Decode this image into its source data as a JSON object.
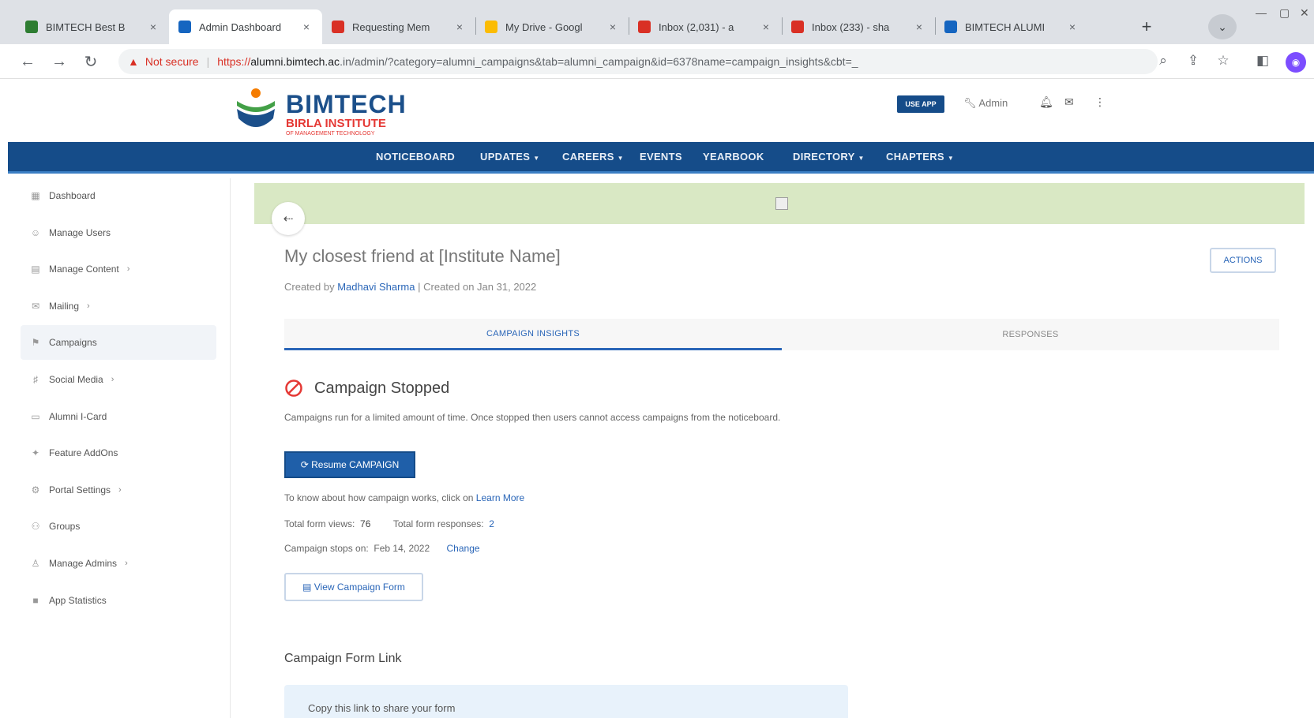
{
  "browser": {
    "tabs": [
      {
        "title": "BIMTECH Best B",
        "favicon_color": "#2e7d32"
      },
      {
        "title": "Admin Dashboard",
        "favicon_color": "#1565c0"
      },
      {
        "title": "Requesting Mem",
        "favicon_color": "#d93025"
      },
      {
        "title": "My Drive - Googl",
        "favicon_color": "#fbbc04"
      },
      {
        "title": "Inbox (2,031) - a",
        "favicon_color": "#d93025"
      },
      {
        "title": "Inbox (233) - sha",
        "favicon_color": "#d93025"
      },
      {
        "title": "BIMTECH ALUMI",
        "favicon_color": "#1565c0"
      }
    ],
    "active_tab": 1,
    "tab_close": "×",
    "new_tab": "+",
    "tab_search": "⌄",
    "address": {
      "warning_label": "Not secure",
      "scheme": "https://",
      "host": "alumni.bimtech.ac",
      "path": ".in/admin/?category=alumni_campaigns&tab=alumni_campaign&id=6378name=campaign_insights&cbt=_"
    }
  },
  "site": {
    "logo_word": "BIMTECH",
    "logo_sub": "BIRLA INSTITUTE",
    "logo_sub2": "OF MANAGEMENT TECHNOLOGY",
    "use_app": "USE APP",
    "admin": "Admin",
    "nav": [
      {
        "label": "NOTICEBOARD",
        "caret": false
      },
      {
        "label": "UPDATES",
        "caret": true
      },
      {
        "label": "CAREERS",
        "caret": true
      },
      {
        "label": "EVENTS",
        "caret": false
      },
      {
        "label": "YEARBOOK",
        "caret": false
      },
      {
        "label": "DIRECTORY",
        "caret": true
      },
      {
        "label": "CHAPTERS",
        "caret": true
      }
    ]
  },
  "sidebar": {
    "items": [
      {
        "label": "Dashboard",
        "icon": "grid-icon",
        "chevron": false
      },
      {
        "label": "Manage Users",
        "icon": "users-icon",
        "chevron": false
      },
      {
        "label": "Manage Content",
        "icon": "content-icon",
        "chevron": true
      },
      {
        "label": "Mailing",
        "icon": "mail-icon",
        "chevron": true
      },
      {
        "label": "Campaigns",
        "icon": "campaign-icon",
        "chevron": false
      },
      {
        "label": "Social Media",
        "icon": "social-icon",
        "chevron": true
      },
      {
        "label": "Alumni I-Card",
        "icon": "card-icon",
        "chevron": false
      },
      {
        "label": "Feature AddOns",
        "icon": "feature-icon",
        "chevron": false
      },
      {
        "label": "Portal Settings",
        "icon": "settings-icon",
        "chevron": true
      },
      {
        "label": "Groups",
        "icon": "groups-icon",
        "chevron": false
      },
      {
        "label": "Manage Admins",
        "icon": "admins-icon",
        "chevron": true
      },
      {
        "label": "App Statistics",
        "icon": "stats-icon",
        "chevron": false
      }
    ],
    "active": 4
  },
  "main": {
    "title": "My closest friend at [Institute Name]",
    "created_by_label": "Created by",
    "created_by": "Madhavi Sharma",
    "created_on": "Created on Jan 31, 2022",
    "actions": "ACTIONS",
    "tabs": [
      "CAMPAIGN INSIGHTS",
      "RESPONSES"
    ],
    "status_title": "Campaign Stopped",
    "status_desc": "Campaigns run for a limited amount of time. Once stopped then users cannot access campaigns from the noticeboard.",
    "resume_label": "Resume CAMPAIGN",
    "learn_text": "To know about how campaign works, click on",
    "learn_link": "Learn More",
    "views_label": "Total form views",
    "views_value": "76",
    "responses_label": "Total form responses",
    "responses_value": "2",
    "stops_label": "Campaign stops on",
    "stops_value": "Feb 14, 2022",
    "change": "Change",
    "view_form": "View Campaign Form",
    "link_section": "Campaign Form Link",
    "link_box_text": "Copy this link to share your form"
  },
  "colors": {
    "brand_blue": "#154c89",
    "link_blue": "#2a66b8",
    "banner_green": "#d9e8c4",
    "stop_red": "#e53935"
  }
}
